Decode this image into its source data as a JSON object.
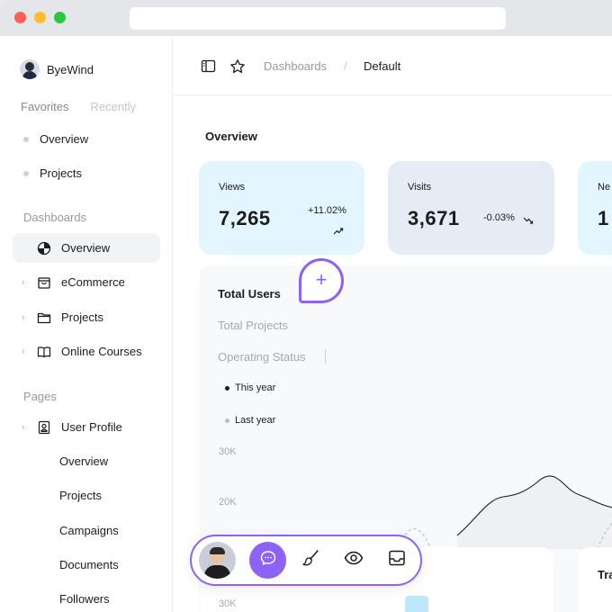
{
  "sidebar": {
    "brand": "ByeWind",
    "fav_tabs": [
      "Favorites",
      "Recently"
    ],
    "favorites": [
      "Overview",
      "Projects"
    ],
    "dashboards_label": "Dashboards",
    "dashboards": [
      {
        "label": "Overview",
        "icon": "pie-chart-icon",
        "active": true
      },
      {
        "label": "eCommerce",
        "icon": "shopping-bag-icon"
      },
      {
        "label": "Projects",
        "icon": "folder-icon"
      },
      {
        "label": "Online Courses",
        "icon": "book-icon"
      }
    ],
    "pages_label": "Pages",
    "user_profile": "User Profile",
    "subitems": [
      "Overview",
      "Projects",
      "Campaigns",
      "Documents",
      "Followers"
    ]
  },
  "header": {
    "breadcrumb_parent": "Dashboards",
    "breadcrumb_sep": "/",
    "breadcrumb_current": "Default"
  },
  "overview": {
    "title": "Overview",
    "cards": [
      {
        "label": "Views",
        "value": "7,265",
        "change": "+11.02%",
        "trend": "up"
      },
      {
        "label": "Visits",
        "value": "3,671",
        "change": "-0.03%",
        "trend": "down"
      },
      {
        "label": "Ne",
        "value": "1"
      }
    ]
  },
  "chart": {
    "tabs": [
      "Total Users",
      "Total Projects",
      "Operating Status"
    ],
    "legend": [
      {
        "label": "This year",
        "color": "#1c1c1c"
      },
      {
        "label": "Last year",
        "color": "#a8c5da"
      }
    ],
    "yticks": [
      "30K",
      "20K"
    ]
  },
  "bottom": {
    "ytick": "30K",
    "right_title": "Tra"
  },
  "colors": {
    "accent": "#8c62f7",
    "card_blue": "#e3f5ff",
    "card_grey": "#e5ecf6"
  }
}
